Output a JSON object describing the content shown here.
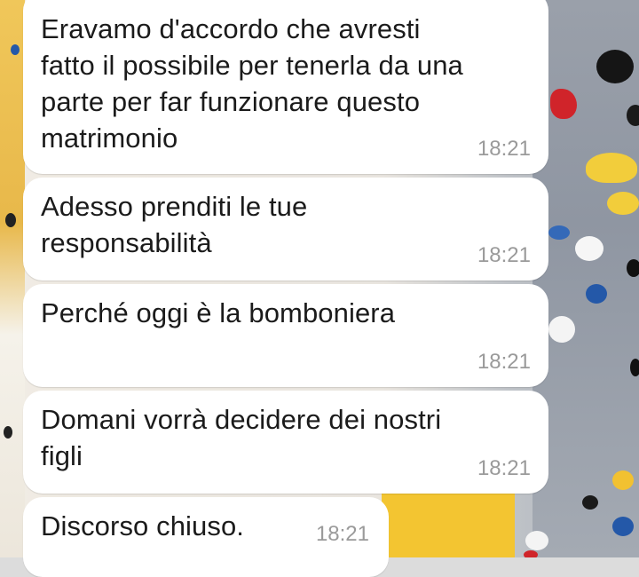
{
  "messages": [
    {
      "text": "Eravamo d'accordo che avresti\nfatto il possibile per tenerla da una\nparte per far funzionare questo\nmatrimonio",
      "time": "18:21"
    },
    {
      "text": "Adesso prenditi le tue\nresponsabilità",
      "time": "18:21"
    },
    {
      "text": "Perché oggi è la bomboniera",
      "time": "18:21"
    },
    {
      "text": "Domani vorrà decidere dei nostri\nfigli",
      "time": "18:21"
    },
    {
      "text": "Discorso chiuso.",
      "time": "18:21"
    }
  ],
  "colors": {
    "bubble": "#ffffff",
    "text": "#1b1b1b",
    "timestamp": "#9a9a9a"
  }
}
